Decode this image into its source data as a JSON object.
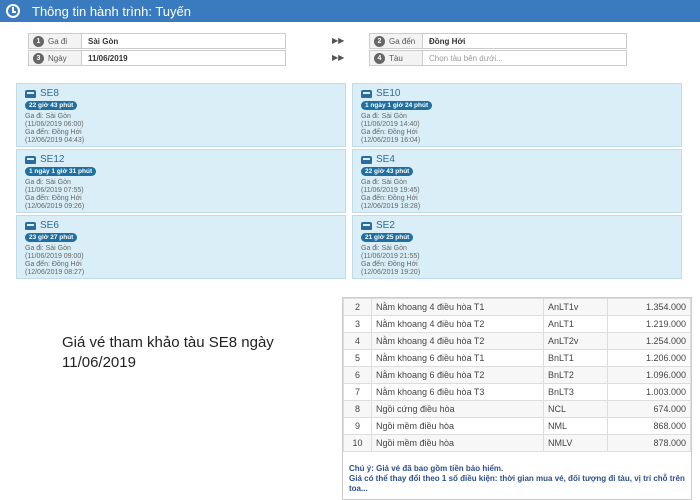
{
  "header": {
    "title": "Thông tin hành trình: Tuyến"
  },
  "form": {
    "depart": {
      "num": "1",
      "label": "Ga đi",
      "value": "Sài Gòn"
    },
    "date": {
      "num": "3",
      "label": "Ngày",
      "value": "11/06/2019"
    },
    "arrive": {
      "num": "2",
      "label": "Ga đến",
      "value": "Đồng Hới"
    },
    "train": {
      "num": "4",
      "label": "Tàu",
      "placeholder": "Chọn tàu bên dưới..."
    }
  },
  "trains": [
    {
      "name": "SE8",
      "duration": "22 giờ 43 phút",
      "depart_station": "Ga đi: Sài Gòn",
      "depart_time": "(11/06/2019 06:00)",
      "arrive_station": "Ga đến: Đồng Hới",
      "arrive_time": "(12/06/2019 04:43)"
    },
    {
      "name": "SE10",
      "duration": "1 ngày 1 giờ 24 phút",
      "depart_station": "Ga đi: Sài Gòn",
      "depart_time": "(11/06/2019 14:40)",
      "arrive_station": "Ga đến: Đồng Hới",
      "arrive_time": "(12/06/2019 16:04)"
    },
    {
      "name": "SE12",
      "duration": "1 ngày 1 giờ 31 phút",
      "depart_station": "Ga đi: Sài Gòn",
      "depart_time": "(11/06/2019 07:55)",
      "arrive_station": "Ga đến: Đồng Hới",
      "arrive_time": "(12/06/2019 09:26)"
    },
    {
      "name": "SE4",
      "duration": "22 giờ 43 phút",
      "depart_station": "Ga đi: Sài Gòn",
      "depart_time": "(11/06/2019 19:45)",
      "arrive_station": "Ga đến: Đồng Hới",
      "arrive_time": "(12/06/2019 18:28)"
    },
    {
      "name": "SE6",
      "duration": "23 giờ 27 phút",
      "depart_station": "Ga đi: Sài Gòn",
      "depart_time": "(11/06/2019 09:00)",
      "arrive_station": "Ga đến: Đồng Hới",
      "arrive_time": "(12/06/2019 08:27)"
    },
    {
      "name": "SE2",
      "duration": "21 giờ 25 phút",
      "depart_station": "Ga đi: Sài Gòn",
      "depart_time": "(11/06/2019 21:55)",
      "arrive_station": "Ga đến: Đồng Hới",
      "arrive_time": "(12/06/2019 19:20)"
    }
  ],
  "caption": "Giá vé tham khảo tàu SE8 ngày 11/06/2019",
  "prices": [
    {
      "idx": "2",
      "name": "Nằm khoang 4 điều hòa T1",
      "code": "AnLT1v",
      "price": "1.354.000"
    },
    {
      "idx": "3",
      "name": "Nằm khoang 4 điều hòa T2",
      "code": "AnLT1",
      "price": "1.219.000"
    },
    {
      "idx": "4",
      "name": "Nằm khoang 4 điều hòa T2",
      "code": "AnLT2v",
      "price": "1.254.000"
    },
    {
      "idx": "5",
      "name": "Nằm khoang 6 điều hòa T1",
      "code": "BnLT1",
      "price": "1.206.000"
    },
    {
      "idx": "6",
      "name": "Nằm khoang 6 điều hòa T2",
      "code": "BnLT2",
      "price": "1.096.000"
    },
    {
      "idx": "7",
      "name": "Nằm khoang 6 điều hòa T3",
      "code": "BnLT3",
      "price": "1.003.000"
    },
    {
      "idx": "8",
      "name": "Ngồi cứng điều hòa",
      "code": "NCL",
      "price": "674.000"
    },
    {
      "idx": "9",
      "name": "Ngồi mềm điều hòa",
      "code": "NML",
      "price": "868.000"
    },
    {
      "idx": "10",
      "name": "Ngồi mềm điều hòa",
      "code": "NMLV",
      "price": "878.000"
    }
  ],
  "note": {
    "line1": "Chú ý: Giá vé đã bao gồm tiền bảo hiểm.",
    "line2": "Giá có thể thay đổi theo 1 số điều kiện: thời gian mua vé, đối tượng đi tàu, vị trí chỗ trên toa..."
  }
}
